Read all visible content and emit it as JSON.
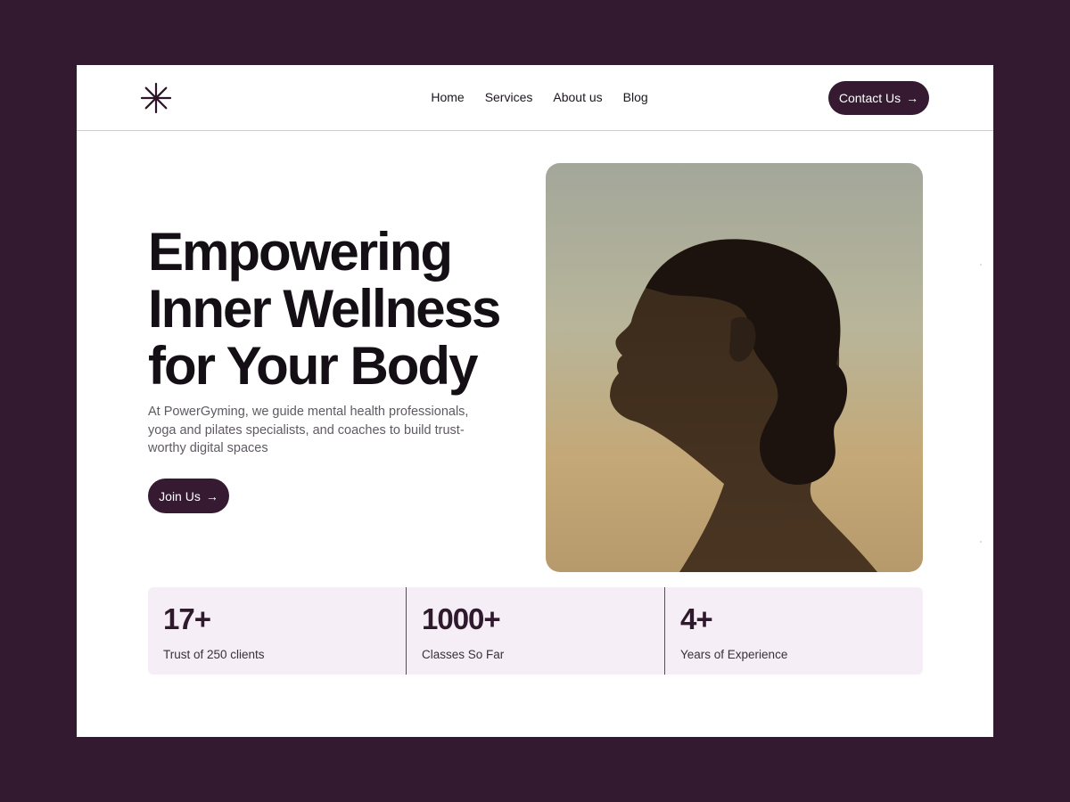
{
  "header": {
    "logo_icon": "asterisk-logo-icon",
    "nav": [
      "Home",
      "Services",
      "About us",
      "Blog"
    ],
    "contact_label": "Contact Us",
    "contact_icon": "arrow-right-icon"
  },
  "hero": {
    "title_lines": [
      "Empowering",
      "Inner Wellness",
      "for Your Body"
    ],
    "description": "At PowerGyming, we guide mental health professionals, yoga and pilates specialists, and coaches to build trust-worthy digital spaces",
    "join_label": "Join Us",
    "join_icon": "arrow-right-icon"
  },
  "stats": [
    {
      "value": "17+",
      "label": "Trust of 250 clients"
    },
    {
      "value": "1000+",
      "label": "Classes So Far"
    },
    {
      "value": "4+",
      "label": "Years of Experience"
    }
  ],
  "colors": {
    "background": "#331a30",
    "primary": "#351a31",
    "stats_bg": "#f5eef6",
    "heading": "#140f15"
  }
}
